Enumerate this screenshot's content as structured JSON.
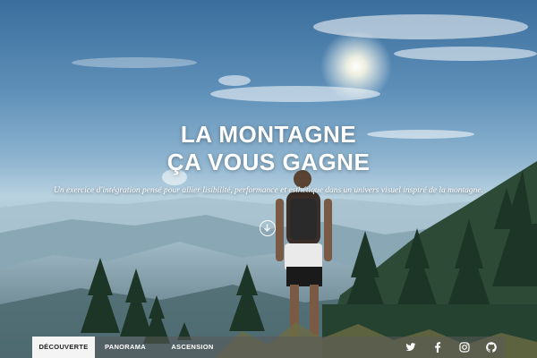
{
  "hero": {
    "title_line1": "LA MONTAGNE",
    "title_line2": "ÇA VOUS GAGNE",
    "tagline": "Un exercice d'intégration pensé pour allier lisibilité, performance et esthétique dans un univers visuel inspiré de la montagne.",
    "scroll_icon": "arrow-down-icon"
  },
  "nav": {
    "tabs": [
      {
        "label": "Découverte",
        "active": true
      },
      {
        "label": "Panorama",
        "active": false
      },
      {
        "label": "Ascension",
        "active": false
      }
    ],
    "social": [
      {
        "icon": "twitter-icon"
      },
      {
        "icon": "facebook-icon"
      },
      {
        "icon": "instagram-icon"
      },
      {
        "icon": "github-icon"
      }
    ]
  },
  "colors": {
    "sky_top": "#3b6e9c",
    "haze": "#b9d2e0",
    "forest": "#1f3a2a",
    "nav_bg": "#5a5a5a",
    "active_tab_bg": "#f4f4f4"
  }
}
